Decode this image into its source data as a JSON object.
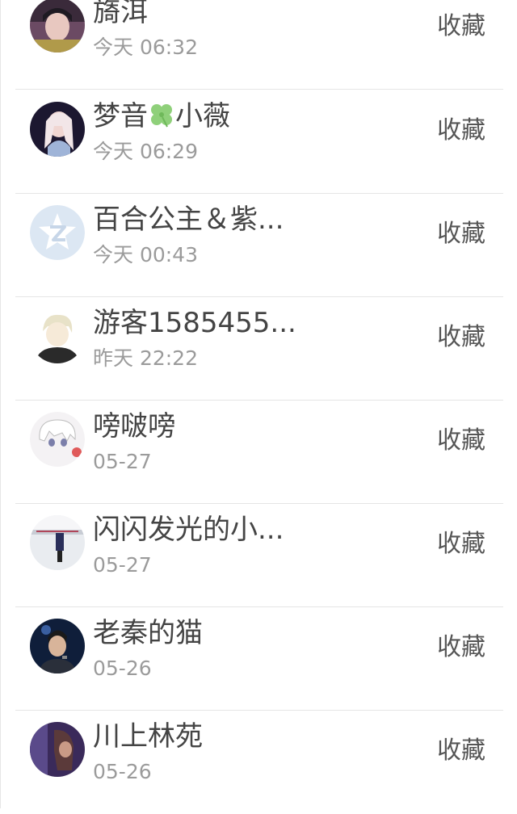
{
  "items": [
    {
      "name": "旖洱",
      "time": "今天 06:32",
      "action": "收藏"
    },
    {
      "name_prefix": "梦音",
      "name_suffix": "小薇",
      "time": "今天 06:29",
      "action": "收藏"
    },
    {
      "name": "百合公主＆紫...",
      "time": "今天 00:43",
      "action": "收藏"
    },
    {
      "name": "游客1585455...",
      "time": "昨天 22:22",
      "action": "收藏"
    },
    {
      "name": "嗙啵嗙",
      "time": "05-27",
      "action": "收藏"
    },
    {
      "name": "闪闪发光的小...",
      "time": "05-27",
      "action": "收藏"
    },
    {
      "name": "老秦的猫",
      "time": "05-26",
      "action": "收藏"
    },
    {
      "name": "川上林苑",
      "time": "05-26",
      "action": "收藏"
    }
  ],
  "icons": {
    "clover": "four-leaf-clover-icon",
    "default_avatar": "qzone-star-icon"
  },
  "colors": {
    "name": "#444444",
    "time": "#9b9b9b",
    "action": "#555555",
    "divider": "#e5e5e5"
  }
}
